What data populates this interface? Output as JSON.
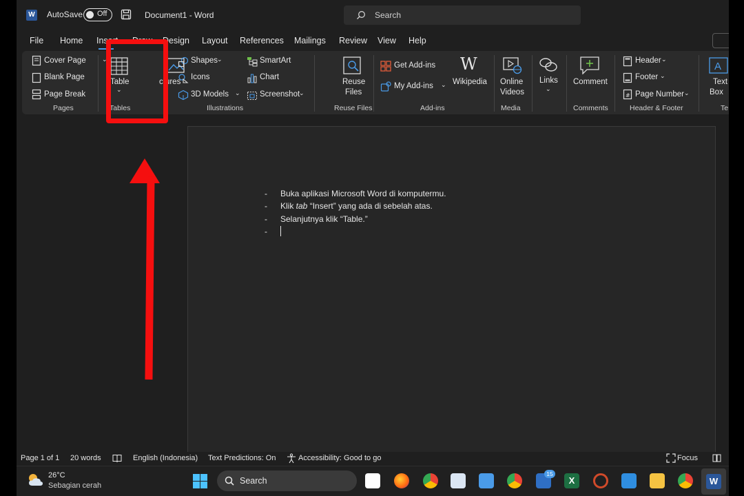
{
  "titlebar": {
    "autosave_label": "AutoSave",
    "autosave_state": "Off",
    "document_title": "Document1  -  Word",
    "search_placeholder": "Search"
  },
  "tabs": [
    {
      "label": "File"
    },
    {
      "label": "Home"
    },
    {
      "label": "Insert"
    },
    {
      "label": "Draw"
    },
    {
      "label": "Design"
    },
    {
      "label": "Layout"
    },
    {
      "label": "References"
    },
    {
      "label": "Mailings"
    },
    {
      "label": "Review"
    },
    {
      "label": "View"
    },
    {
      "label": "Help"
    }
  ],
  "ribbon": {
    "pages": {
      "cover_page": "Cover Page",
      "blank_page": "Blank Page",
      "page_break": "Page Break",
      "group": "Pages"
    },
    "tables": {
      "table": "Table",
      "group": "Tables"
    },
    "illustrations": {
      "pictures": "ctures",
      "shapes": "Shapes",
      "icons": "Icons",
      "models3d": "3D Models",
      "smartart": "SmartArt",
      "chart": "Chart",
      "screenshot": "Screenshot",
      "group": "Illustrations"
    },
    "reuse": {
      "line1": "Reuse",
      "line2": "Files",
      "group": "Reuse Files"
    },
    "addins": {
      "get": "Get Add-ins",
      "my": "My Add-ins",
      "wikipedia": "Wikipedia",
      "group": "Add-ins"
    },
    "media": {
      "line1": "Online",
      "line2": "Videos",
      "group": "Media"
    },
    "links": {
      "label": "Links"
    },
    "comments": {
      "comment": "Comment",
      "group": "Comments"
    },
    "header_footer": {
      "header": "Header",
      "footer": "Footer",
      "page_number": "Page Number",
      "group": "Header & Footer"
    },
    "text": {
      "line1": "Text",
      "line2": "Box",
      "group": "Te"
    }
  },
  "document": {
    "lines": [
      {
        "before": "Buka aplikasi Microsoft Word di komputermu.",
        "italic": "",
        "after": ""
      },
      {
        "before": "Klik ",
        "italic": "tab",
        "after": " “Insert” yang ada di sebelah atas."
      },
      {
        "before": "Selanjutnya klik “Table.”",
        "italic": "",
        "after": ""
      },
      {
        "before": "",
        "italic": "",
        "after": ""
      }
    ],
    "bullet": "-"
  },
  "statusbar": {
    "page": "Page 1 of 1",
    "words": "20 words",
    "language": "English (Indonesia)",
    "predictions": "Text Predictions: On",
    "accessibility": "Accessibility: Good to go",
    "focus": "Focus"
  },
  "taskbar": {
    "temperature": "26°C",
    "weather": "Sebagian cerah",
    "search": "Search",
    "badge": "15"
  },
  "colors": {
    "accent": "#4a9be8",
    "annotation": "#f50f0f",
    "word_blue": "#2b579a",
    "excel_green": "#1d6f42"
  }
}
